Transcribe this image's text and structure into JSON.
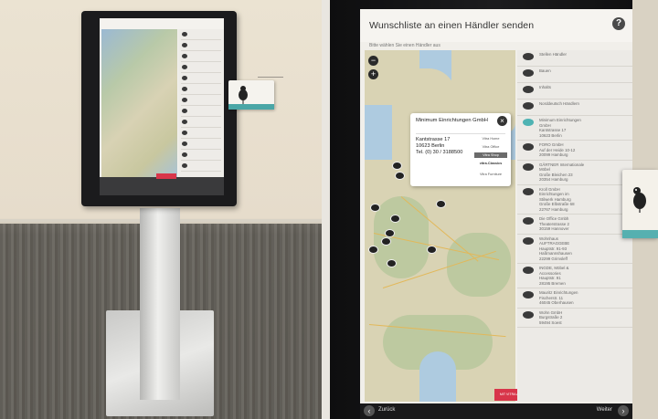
{
  "right_screen": {
    "title": "Wunschliste an einen Händler senden",
    "subtitle": "Bitte wählen Sie einen Händler aus",
    "help_icon": "?",
    "zoom_out": "−",
    "zoom_in": "+",
    "popup": {
      "name": "Minimum Einrichtungen GmbH",
      "address": "Kantstrasse 17\n10623 Berlin\nTel. (0) 30 / 3188500",
      "brands": [
        "Vitra Home",
        "Vitra Office",
        "Vitra Shop",
        "vitra.Classics",
        "Vitra Furniture"
      ],
      "close": "×"
    },
    "map_button": "MIT VITRA ANFRAGEN",
    "list": [
      {
        "text": "Stellen Händler",
        "active": false
      },
      {
        "text": "Bauen",
        "active": false
      },
      {
        "text": "Inhalts",
        "active": false
      },
      {
        "text": "Norddeutsch Händlern",
        "active": false
      },
      {
        "text": "Minimum Einrichtungen\nGmbH\nKantstrasse 17\n10623 Berlin",
        "active": true
      },
      {
        "text": "FORO GmbH\nAuf der Heide 10-12\n20099 Hamburg",
        "active": false
      },
      {
        "text": "GÄRTNER Internationale\nMöbel\nGroße Bleichen 23\n20354 Hamburg",
        "active": false
      },
      {
        "text": "Kroll GmbH\nEinrichtungen im\nStilwerk Hamburg\nGroße Elbstraße 68\n22767 Hamburg",
        "active": false
      },
      {
        "text": "Die Office Gmbh\nTheaterstrasse 2\n30159 Hannover",
        "active": false
      },
      {
        "text": "Wohnhaus\nAUFTRAGGEBE\nHauptstr. 91-93\nHaßmannshausen\n22299 Grimsleff",
        "active": false
      },
      {
        "text": "INGDE, Möbel &\nAccessories\nHauptstr. 91\n28195 Bremen",
        "active": false
      },
      {
        "text": "Mauritz Einrichtungen\nFischerstr. 11\n46045 Oberhausen",
        "active": false
      },
      {
        "text": "Wohn GmbH\nBurgstraße 2\n59494 Soest",
        "active": false
      }
    ],
    "footer": {
      "back": "Zurück",
      "next": "Weiter",
      "back_icon": "‹",
      "next_icon": "›"
    }
  }
}
